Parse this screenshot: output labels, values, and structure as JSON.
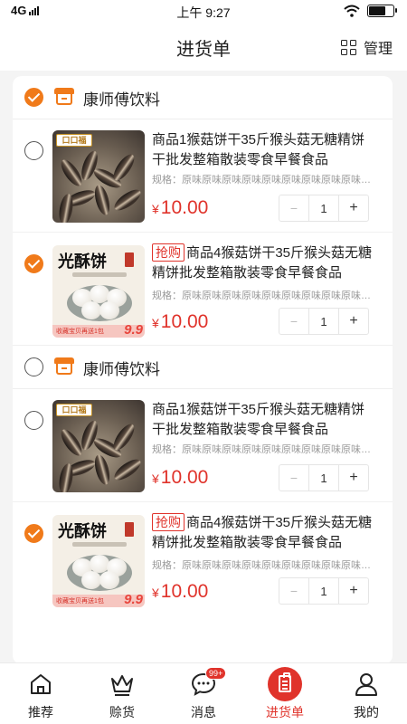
{
  "status_bar": {
    "network": "4G",
    "time": "上午 9:27"
  },
  "header": {
    "title": "进货单",
    "manage_label": "管理",
    "manage_icon": "grid-icon"
  },
  "groups": [
    {
      "store_name": "康师傅饮料",
      "checked": true,
      "items": [
        {
          "checked": false,
          "tag": "",
          "title": "商品1猴菇饼干35斤猴头菇无糖精饼干批发整箱散装零食早餐食品",
          "spec": "规格：原味原味原味原味原味原味原味原味原味原味原味",
          "currency": "¥",
          "price": "10.00",
          "quantity": "1",
          "image": "seeds",
          "image_badge": "口口福"
        },
        {
          "checked": true,
          "tag": "抢购",
          "title": "商品4猴菇饼干35斤猴头菇无糖精饼批发整箱散装零食早餐食品",
          "spec": "规格：原味原味原味原味原味原味原味原味原味原味原味",
          "currency": "¥",
          "price": "10.00",
          "quantity": "1",
          "image": "cake",
          "image_title": "光酥饼",
          "image_strip": "收藏宝贝再送1包",
          "image_big": "9.9"
        }
      ]
    },
    {
      "store_name": "康师傅饮料",
      "checked": false,
      "items": [
        {
          "checked": false,
          "tag": "",
          "title": "商品1猴菇饼干35斤猴头菇无糖精饼干批发整箱散装零食早餐食品",
          "spec": "规格：原味原味原味原味原味原味原味原味原味原味原味",
          "currency": "¥",
          "price": "10.00",
          "quantity": "1",
          "image": "seeds",
          "image_badge": "口口福"
        },
        {
          "checked": true,
          "tag": "抢购",
          "title": "商品4猴菇饼干35斤猴头菇无糖精饼批发整箱散装零食早餐食品",
          "spec": "规格：原味原味原味原味原味原味原味原味原味原味原味",
          "currency": "¥",
          "price": "10.00",
          "quantity": "1",
          "image": "cake",
          "image_title": "光酥饼",
          "image_strip": "收藏宝贝再送1包",
          "image_big": "9.9"
        }
      ]
    }
  ],
  "stepper": {
    "minus": "−",
    "plus": "+"
  },
  "tab_bar": [
    {
      "label": "推荐",
      "icon": "home-icon",
      "active": false
    },
    {
      "label": "赊货",
      "icon": "crown-icon",
      "active": false
    },
    {
      "label": "消息",
      "icon": "message-icon",
      "active": false,
      "badge": "99+"
    },
    {
      "label": "进货单",
      "icon": "order-list-icon",
      "active": true
    },
    {
      "label": "我的",
      "icon": "user-icon",
      "active": false
    }
  ],
  "colors": {
    "accent": "#f07a1a",
    "price_red": "#e0332b"
  }
}
